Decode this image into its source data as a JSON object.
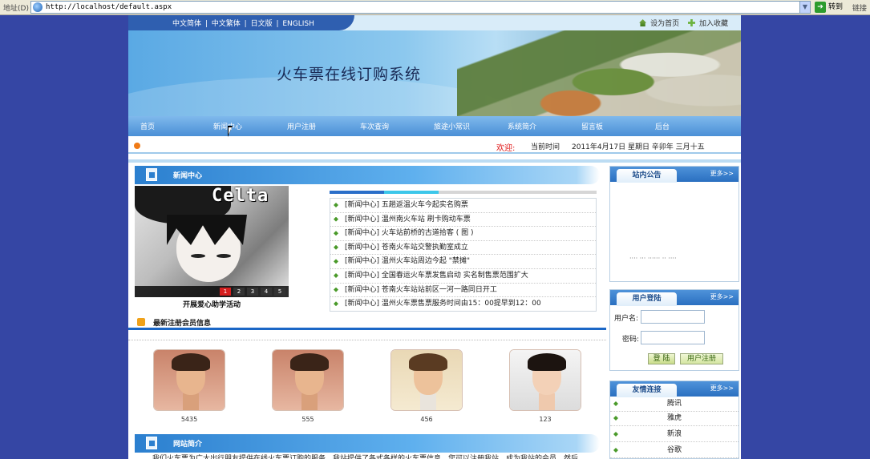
{
  "browser": {
    "address_label": "地址(D)",
    "url": "http://localhost/default.aspx",
    "go_label": "转到",
    "links_label": "链接"
  },
  "header": {
    "languages": [
      "中文简体",
      "中文繁体",
      "日文版",
      "ENGLISH"
    ],
    "set_home": "设为首页",
    "add_favorite": "加入收藏",
    "site_title": "火车票在线订购系统"
  },
  "nav": {
    "items": [
      "首页",
      "新闻中心",
      "用户注册",
      "车次查询",
      "旅途小常识",
      "系统简介",
      "留言板",
      "后台"
    ]
  },
  "infobar": {
    "welcome": "欢迎:",
    "current_time_label": "当前时间",
    "current_time": "2011年4月17日  星期日  辛卯年  三月十五"
  },
  "news": {
    "section_title": "新闻中心",
    "photo_overlay_text": "Celta",
    "photo_caption": "开展爱心助学活动",
    "photo_pages": [
      "1",
      "2",
      "3",
      "4",
      "5"
    ],
    "items": [
      "[新闻中心] 五趟返温火车今起实名购票",
      "[新闻中心] 温州南火车站  刷卡购动车票",
      "[新闻中心] 火车站前桥的古道拾客 ( 图 )",
      "[新闻中心] 苍南火车站交警执勤室成立",
      "[新闻中心] 温州火车站周边今起 \"禁摊\"",
      "[新闻中心] 全国春运火车票发售启动  实名制售票范围扩大",
      "[新闻中心] 苍南火车站站前区一河一路同日开工",
      "[新闻中心] 温州火车票售票服务时间由15：00提早到12：00"
    ]
  },
  "members": {
    "section_title": "最新注册会员信息",
    "list": [
      {
        "label": "5435"
      },
      {
        "label": "555"
      },
      {
        "label": "456"
      },
      {
        "label": "123"
      }
    ]
  },
  "intro": {
    "section_title": "网站简介",
    "text": "我们火车票为广大出行朋友提供在线火车票订购的服务，我站提供了各式各样的火车票信息，您可以注册我站，成为我站的会员，然后"
  },
  "notice": {
    "title": "站内公告",
    "more": "更多>>",
    "ghost_text": "···· ··· ······ ·· ····"
  },
  "login": {
    "title": "用户登陆",
    "more": "更多>>",
    "username_label": "用户名:",
    "password_label": "密码:",
    "login_button": "登 陆",
    "register_button": "用户注册"
  },
  "friend_links": {
    "title": "友情连接",
    "more": "更多>>",
    "items": [
      "腾讯",
      "雅虎",
      "新浪",
      "谷歌"
    ]
  }
}
